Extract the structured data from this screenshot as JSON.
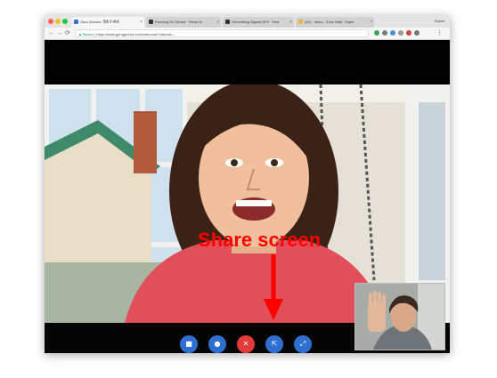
{
  "browser": {
    "profile_name": "Sujeet",
    "tabs": [
      {
        "label": "Guru Gooroo: हिंदी में सीखें",
        "close": "×",
        "active": true,
        "favicon_color": "#2f74d8"
      },
      {
        "label": "Running On Device · React N",
        "close": "×",
        "active": false,
        "favicon_color": "#333333"
      },
      {
        "label": "Generating Signed APK · Rea",
        "close": "×",
        "active": false,
        "favicon_color": "#333333"
      },
      {
        "label": "(40) - Inbox - Zoho Mail - Sujee",
        "close": "×",
        "active": false,
        "favicon_color": "#f2b33d"
      }
    ],
    "nav": {
      "back": "←",
      "forward": "→",
      "reload": "⟳"
    },
    "address": {
      "secure_label": "Secure",
      "url": "https://www.gurugooroo.com/videocall/?videoId=..."
    },
    "extensions": [
      "#3aa757",
      "#7b7b7b",
      "#4a90d9",
      "#9b9b9b",
      "#cc4444",
      "#777777"
    ]
  },
  "call": {
    "controls": [
      {
        "name": "video-button",
        "icon": "video-camera-icon",
        "glyph": "■",
        "color": "#2f6fd1"
      },
      {
        "name": "mic-button",
        "icon": "microphone-icon",
        "glyph": "●",
        "color": "#2f6fd1"
      },
      {
        "name": "end-call-button",
        "icon": "close-icon",
        "glyph": "✕",
        "color": "#e23b3b"
      },
      {
        "name": "share-screen-button",
        "icon": "share-screen-icon",
        "glyph": "⇱",
        "color": "#2f6fd1"
      },
      {
        "name": "fullscreen-button",
        "icon": "fullscreen-icon",
        "glyph": "⤢",
        "color": "#2f6fd1"
      }
    ]
  },
  "annotation": {
    "label": "Share screen",
    "color": "#ff0000"
  }
}
